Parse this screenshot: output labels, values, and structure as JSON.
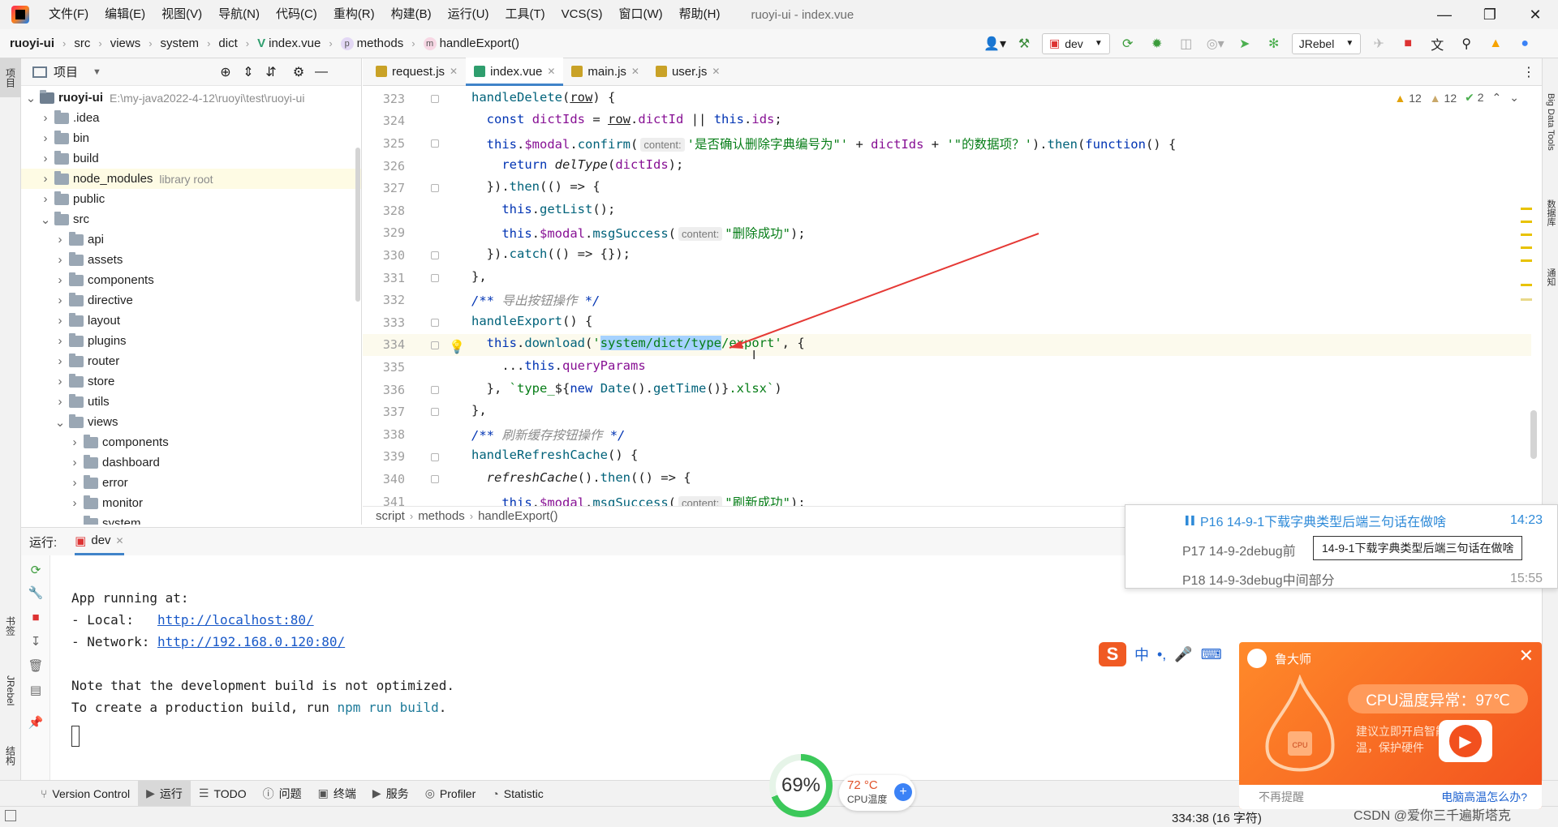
{
  "title_bar": {
    "menus": [
      "文件(F)",
      "编辑(E)",
      "视图(V)",
      "导航(N)",
      "代码(C)",
      "重构(R)",
      "构建(B)",
      "运行(U)",
      "工具(T)",
      "VCS(S)",
      "窗口(W)",
      "帮助(H)"
    ],
    "window_title": "ruoyi-ui - index.vue"
  },
  "nav_bar": {
    "breadcrumbs": [
      "ruoyi-ui",
      "src",
      "views",
      "system",
      "dict",
      "index.vue",
      "methods",
      "handleExport()"
    ],
    "run_config": "dev",
    "jrebel_config": "JRebel"
  },
  "left_strip": {
    "project_tab": "项目",
    "bookmarks_tab": "书签",
    "jrebel_tab": "JRebel",
    "structure_tab": "结构"
  },
  "project_panel": {
    "title": "项目",
    "tree": [
      {
        "label": "ruoyi-ui",
        "sub": "E:\\my-java2022-4-12\\ruoyi\\test\\ruoyi-ui",
        "depth": 0,
        "open": true,
        "root": true
      },
      {
        "label": ".idea",
        "sub": "",
        "depth": 1,
        "open": false
      },
      {
        "label": "bin",
        "sub": "",
        "depth": 1,
        "open": false
      },
      {
        "label": "build",
        "sub": "",
        "depth": 1,
        "open": false
      },
      {
        "label": "node_modules",
        "sub": "library root",
        "depth": 1,
        "open": false,
        "lib": true
      },
      {
        "label": "public",
        "sub": "",
        "depth": 1,
        "open": false
      },
      {
        "label": "src",
        "sub": "",
        "depth": 1,
        "open": true
      },
      {
        "label": "api",
        "sub": "",
        "depth": 2,
        "open": false
      },
      {
        "label": "assets",
        "sub": "",
        "depth": 2,
        "open": false
      },
      {
        "label": "components",
        "sub": "",
        "depth": 2,
        "open": false
      },
      {
        "label": "directive",
        "sub": "",
        "depth": 2,
        "open": false
      },
      {
        "label": "layout",
        "sub": "",
        "depth": 2,
        "open": false
      },
      {
        "label": "plugins",
        "sub": "",
        "depth": 2,
        "open": false
      },
      {
        "label": "router",
        "sub": "",
        "depth": 2,
        "open": false
      },
      {
        "label": "store",
        "sub": "",
        "depth": 2,
        "open": false
      },
      {
        "label": "utils",
        "sub": "",
        "depth": 2,
        "open": false
      },
      {
        "label": "views",
        "sub": "",
        "depth": 2,
        "open": true
      },
      {
        "label": "components",
        "sub": "",
        "depth": 3,
        "open": false
      },
      {
        "label": "dashboard",
        "sub": "",
        "depth": 3,
        "open": false
      },
      {
        "label": "error",
        "sub": "",
        "depth": 3,
        "open": false
      },
      {
        "label": "monitor",
        "sub": "",
        "depth": 3,
        "open": false
      },
      {
        "label": "system",
        "sub": "",
        "depth": 3,
        "open": true
      }
    ]
  },
  "editor": {
    "tabs": [
      {
        "label": "request.js",
        "active": false,
        "icon_color": "#c9a227"
      },
      {
        "label": "index.vue",
        "active": true,
        "icon_color": "#2f9e6e"
      },
      {
        "label": "main.js",
        "active": false,
        "icon_color": "#c9a227"
      },
      {
        "label": "user.js",
        "active": false,
        "icon_color": "#c9a227"
      }
    ],
    "inspections": {
      "warnings": "12",
      "weak_warnings": "12",
      "ok": "2"
    },
    "current_line": 334,
    "line_numbers": [
      "323",
      "324",
      "325",
      "326",
      "327",
      "328",
      "329",
      "330",
      "331",
      "332",
      "333",
      "334",
      "335",
      "336",
      "337",
      "338",
      "339",
      "340",
      "341"
    ],
    "breadcrumbs": [
      "script",
      "methods",
      "handleExport()"
    ],
    "hint_label": "content:"
  },
  "run_panel": {
    "label": "运行:",
    "config_tab": "dev",
    "console_lines": [
      "App running at:",
      "- Local:   ",
      "- Network: ",
      "Note that the development build is not optimized.",
      "To create a production build, run "
    ],
    "local_url": "http://localhost:80/",
    "network_url": "http://192.168.0.120:80/",
    "build_cmd": "npm run build",
    "build_end": "."
  },
  "bottom_bar": {
    "items": [
      "Version Control",
      "运行",
      "TODO",
      "问题",
      "终端",
      "服务",
      "Profiler",
      "Statistic"
    ]
  },
  "status_bar": {
    "position": "334:38 (16 字符)"
  },
  "video_list": {
    "items": [
      {
        "label": "P16  14-9-1下载字典类型后端三句话在做啥",
        "time": "14:23",
        "active": true
      },
      {
        "label": "P17  14-9-2debug前",
        "time": "",
        "active": false
      },
      {
        "label": "P18  14-9-3debug中间部分",
        "time": "15:55",
        "active": false
      }
    ],
    "tooltip": "14-9-1下载字典类型后端三句话在做啥"
  },
  "ime": {
    "mode": "中",
    "punct": "•,"
  },
  "cpu_popup": {
    "brand": "鲁大师",
    "headline": "CPU温度异常：97℃",
    "desc": "建议立即开启智能降温，保护硬件",
    "dismiss": "不再提醒",
    "link": "电脑高温怎么办?"
  },
  "cpu_widget": {
    "usage_percent": 69,
    "usage_label": "69%",
    "temp": "72 °C",
    "temp_label": "CPU温度"
  },
  "watermark": "CSDN @爱你三千遍斯塔克",
  "colors": {
    "accent": "#4083c9",
    "keyword": "#0033b3",
    "string": "#067d17",
    "property": "#871094",
    "selection": "#a6d2ff"
  }
}
